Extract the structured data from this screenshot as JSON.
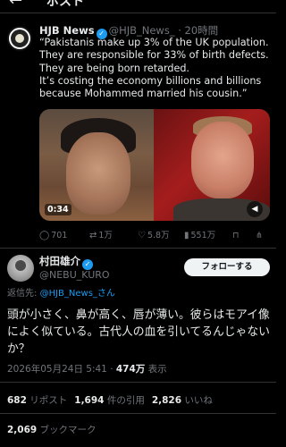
{
  "header": {
    "title": "ポスト"
  },
  "quoted_tweet": {
    "author_name": "HJB News",
    "handle_time": "@HJB_News_ · 20時間",
    "body": "“Pakistanis make up 3% of the UK population.\nThey are responsible for 33% of birth defects.\nThey are being born retarded.\nIt’s costing the economy billions and billions because Mohammed married his cousin.”",
    "media": {
      "duration": "0:34"
    },
    "actions": {
      "replies": "701",
      "reposts": "1万",
      "likes": "5.8万",
      "views": "551万"
    }
  },
  "main_tweet": {
    "author_name": "村田雄介",
    "handle": "@NEBU_KURO",
    "follow_label": "フォローする",
    "reply_to_prefix": "返信先: ",
    "reply_to_handle": "@HJB_News_さん",
    "body": "頭が小さく、鼻が高く、唇が薄い。彼らはモアイ像によく似ている。古代人の血を引いてるんじゃないか？",
    "timestamp": "2026年05月24日 5:41 · ",
    "views_count": "474万",
    "views_label": " 表示",
    "stats": {
      "reposts_count": "682",
      "reposts_label": " リポスト",
      "quotes_count": "1,694",
      "quotes_label": " 件の引用",
      "likes_count": "2,826",
      "likes_label": " いいね",
      "bookmarks_count": "2,069",
      "bookmarks_label": " ブックマーク"
    }
  },
  "icons": {
    "back": "←",
    "reply": "◯",
    "repost": "⇄",
    "like": "♡",
    "views": "▮",
    "bookmark": "⊓",
    "share": "⋔",
    "mute": "◀"
  },
  "colors": {
    "background": "#000000",
    "text": "#e7e9ea",
    "muted": "#71767b",
    "accent": "#1d9bf0",
    "follow_bg": "#eff3f4"
  }
}
